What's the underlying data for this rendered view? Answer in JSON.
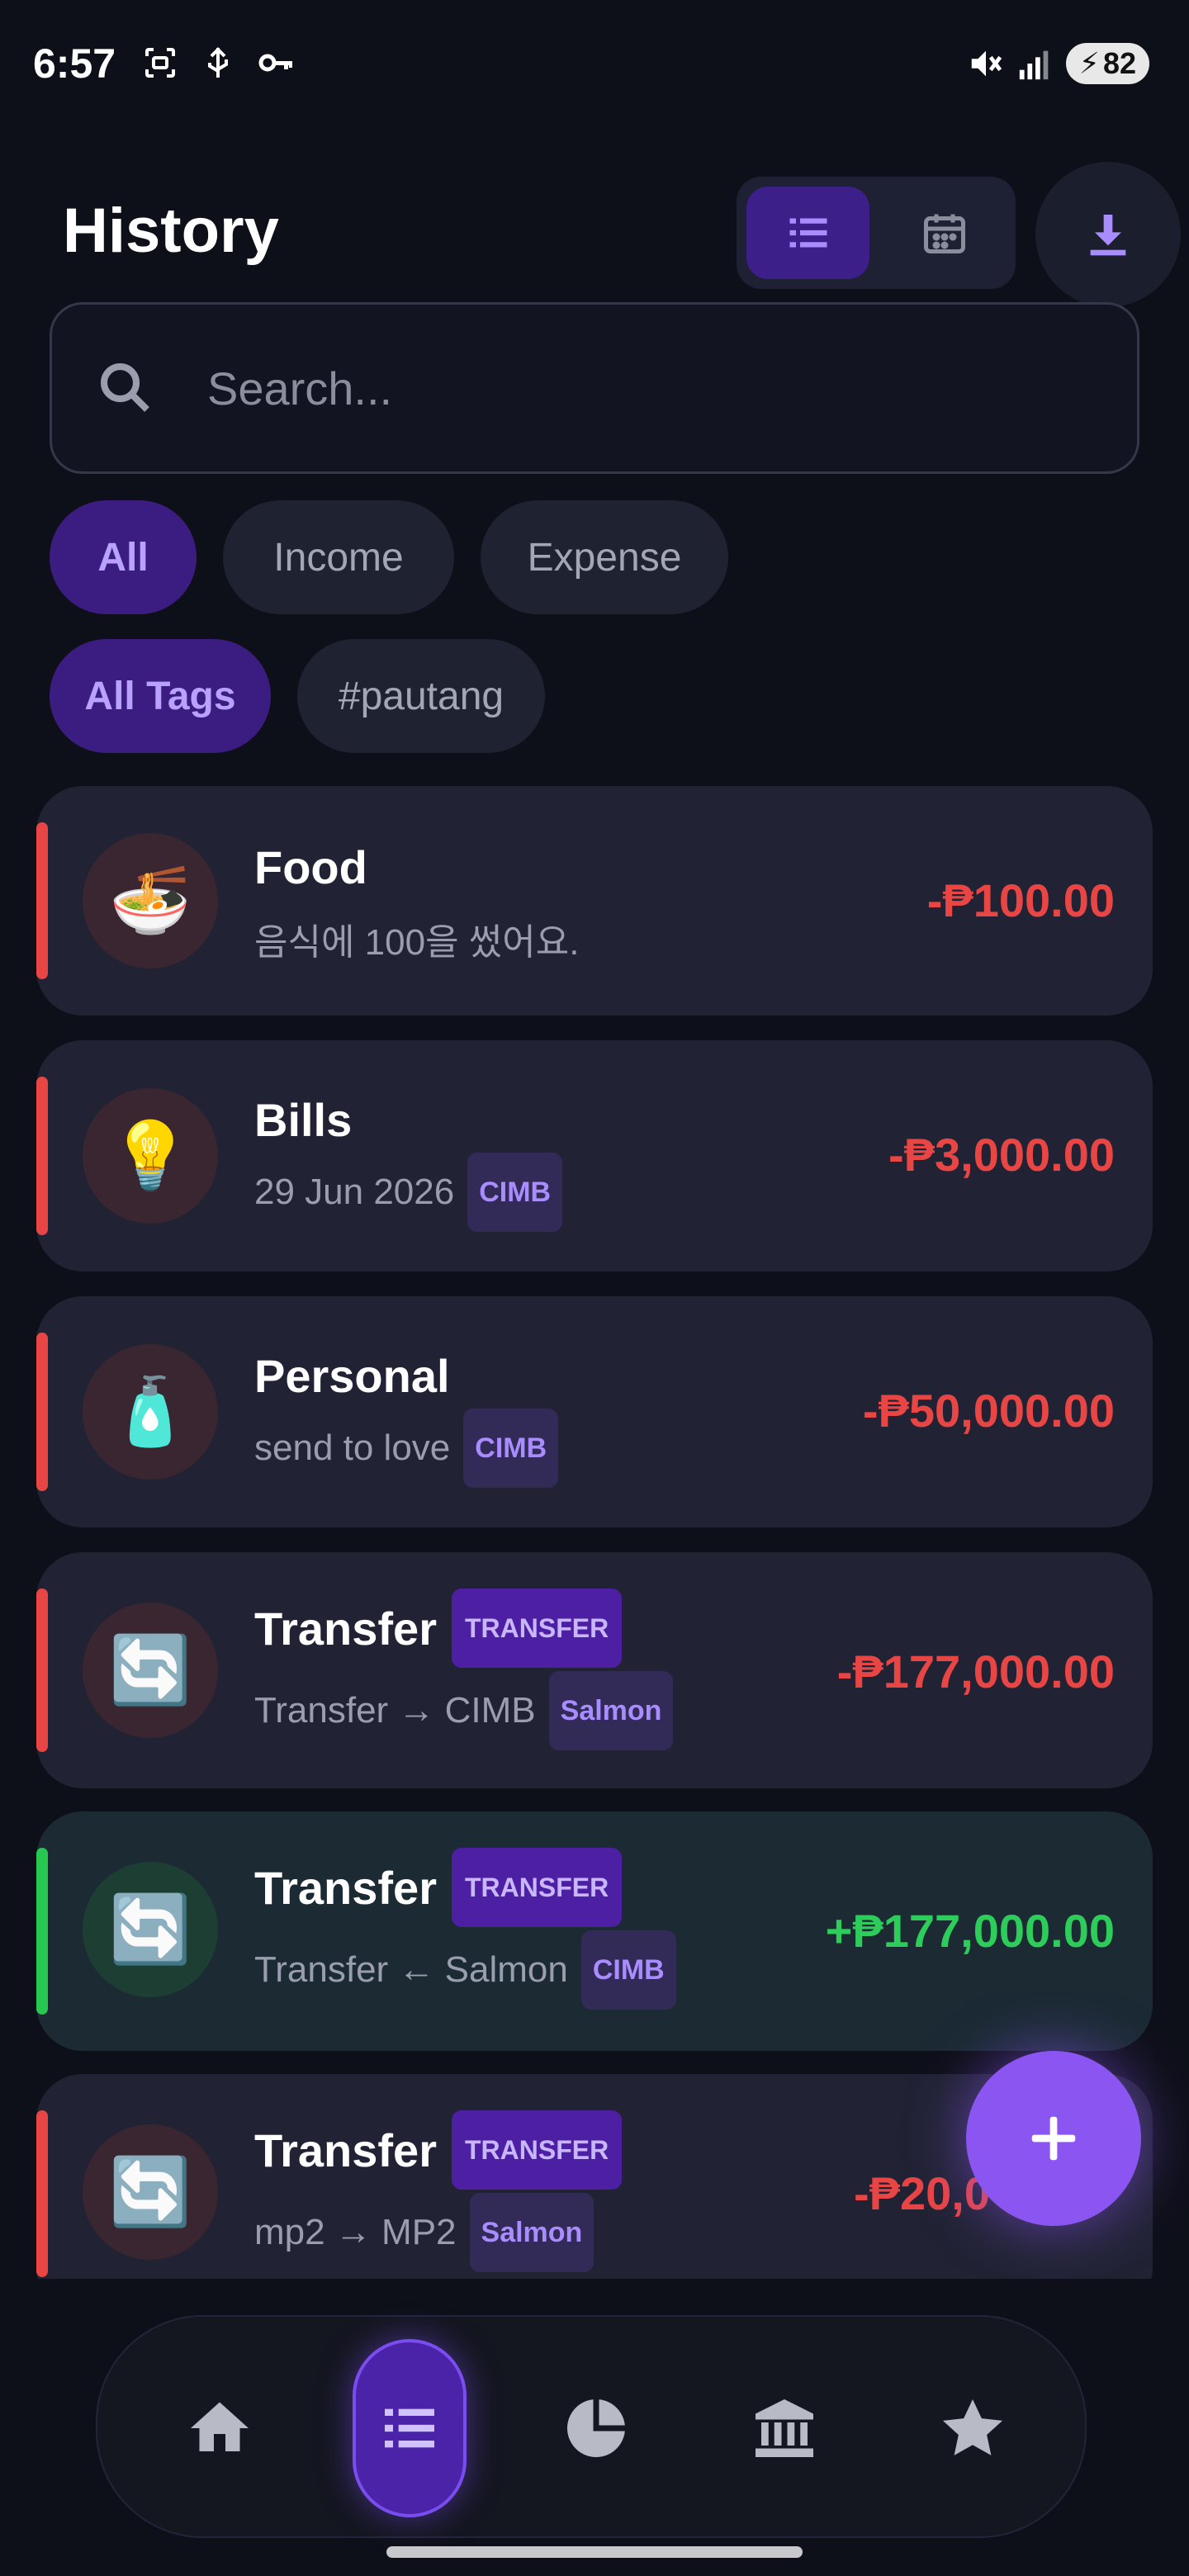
{
  "status_bar": {
    "time": "6:57",
    "battery": "82",
    "icons": [
      "screenshot-icon",
      "usb-icon",
      "key-icon",
      "mute-icon",
      "signal-icon",
      "battery-charging-icon"
    ]
  },
  "header": {
    "title": "History",
    "view_toggle": [
      "list-view-icon",
      "calendar-view-icon"
    ],
    "active_view": "list",
    "download_icon": "download-icon"
  },
  "search": {
    "placeholder": "Search...",
    "value": ""
  },
  "type_filters": [
    {
      "label": "All",
      "active": true
    },
    {
      "label": "Income",
      "active": false
    },
    {
      "label": "Expense",
      "active": false
    }
  ],
  "tag_filters": [
    {
      "label": "All Tags",
      "active": true
    },
    {
      "label": "#pautang",
      "active": false
    }
  ],
  "transactions": [
    {
      "title": "Food",
      "icon": "🍜",
      "subtitle": "음식에 100을 썼어요.",
      "account": "",
      "badge": "",
      "amount": "-₱100.00",
      "kind": "expense"
    },
    {
      "title": "Bills",
      "icon": "💡",
      "subtitle": "29 Jun 2026",
      "account": "CIMB",
      "badge": "",
      "amount": "-₱3,000.00",
      "kind": "expense"
    },
    {
      "title": "Personal",
      "icon": "🧴",
      "subtitle": "send to love",
      "account": "CIMB",
      "badge": "",
      "amount": "-₱50,000.00",
      "kind": "expense"
    },
    {
      "title": "Transfer",
      "icon": "🔄",
      "subtitle": "Transfer → CIMB",
      "account": "Salmon",
      "badge": "TRANSFER",
      "amount": "-₱177,000.00",
      "kind": "expense"
    },
    {
      "title": "Transfer",
      "icon": "🔄",
      "subtitle": "Transfer ← Salmon",
      "account": "CIMB",
      "badge": "TRANSFER",
      "amount": "+₱177,000.00",
      "kind": "income"
    },
    {
      "title": "Transfer",
      "icon": "🔄",
      "subtitle": "mp2 → MP2",
      "account": "Salmon",
      "badge": "TRANSFER",
      "amount": "-₱20,0",
      "kind": "expense"
    }
  ],
  "fab": {
    "icon": "plus-icon"
  },
  "bottom_nav": [
    {
      "name": "home",
      "icon": "home-icon",
      "active": false
    },
    {
      "name": "history",
      "icon": "list-icon",
      "active": true
    },
    {
      "name": "stats",
      "icon": "pie-chart-icon",
      "active": false
    },
    {
      "name": "accounts",
      "icon": "bank-icon",
      "active": false
    },
    {
      "name": "favorites",
      "icon": "star-icon",
      "active": false
    }
  ],
  "colors": {
    "background": "#0e1019",
    "accent": "#8b55f2",
    "expense": "#e84545",
    "income": "#2ecc5a",
    "card": "#212334"
  }
}
